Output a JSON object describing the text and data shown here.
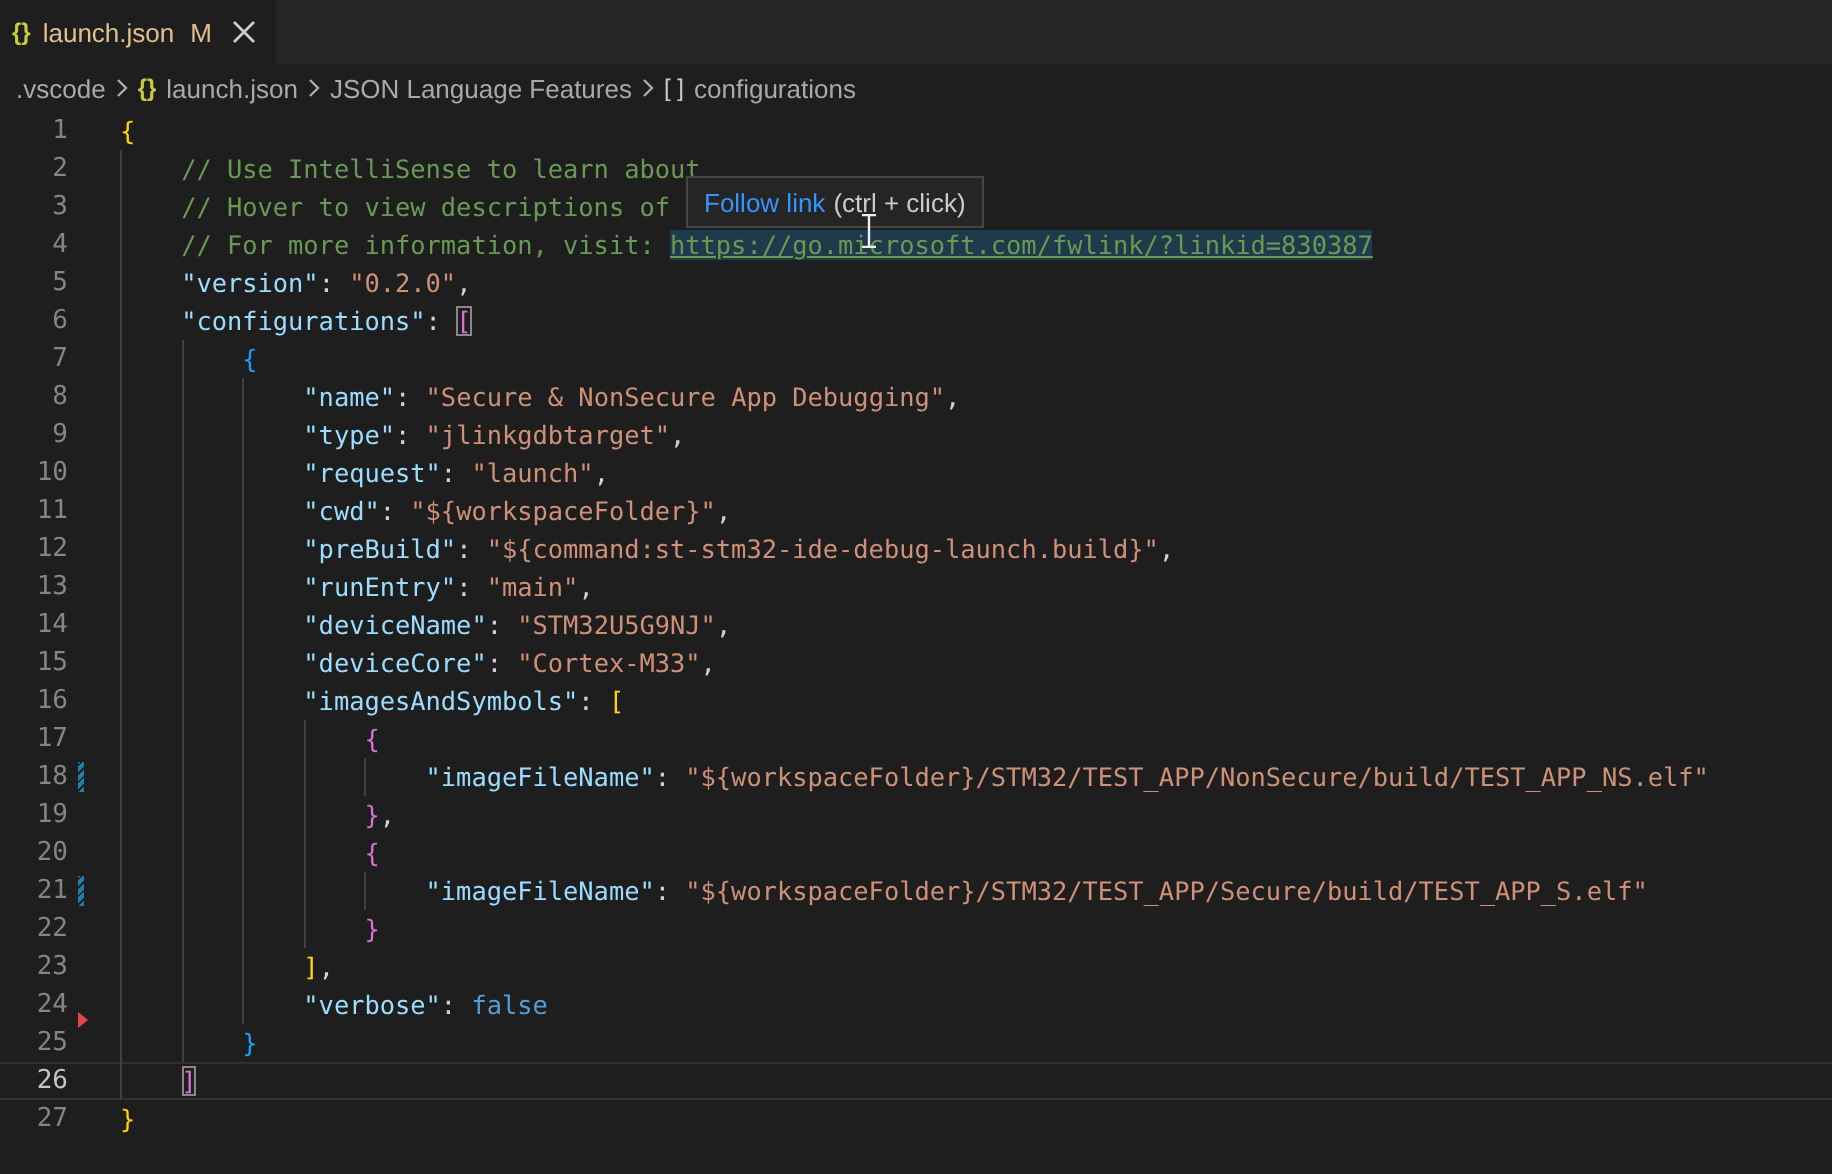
{
  "tab": {
    "icon": "{}",
    "label": "launch.json",
    "status": "M",
    "selected": true
  },
  "breadcrumbs": [
    {
      "label": ".vscode"
    },
    {
      "icon": "{}",
      "label": "launch.json"
    },
    {
      "label": "JSON Language Features"
    },
    {
      "icon": "[ ]",
      "label": "configurations"
    }
  ],
  "lines": [
    {
      "number": "1",
      "tokens": [
        {
          "kind": "bracket",
          "text": "{",
          "color": "#ffd700"
        }
      ]
    },
    {
      "number": "2",
      "tokens": [
        {
          "kind": "comment",
          "text": "    // Use IntelliSense to learn about"
        }
      ]
    },
    {
      "number": "3",
      "tokens": [
        {
          "kind": "comment",
          "text": "    // Hover to view descriptions of"
        }
      ]
    },
    {
      "number": "4",
      "tokens": [
        {
          "kind": "comment",
          "text": "    // For more information, visit: "
        },
        {
          "kind": "link",
          "text": "https://go.microsoft.com/fwlink/?linkid=830387"
        }
      ]
    },
    {
      "number": "5",
      "tokens": [
        {
          "kind": "key",
          "text": "    \"version\""
        },
        {
          "kind": "punct",
          "text": ": "
        },
        {
          "kind": "string",
          "text": "\"0.2.0\""
        },
        {
          "kind": "punct",
          "text": ","
        }
      ]
    },
    {
      "number": "6",
      "tokens": [
        {
          "kind": "key",
          "text": "    \"configurations\""
        },
        {
          "kind": "punct",
          "text": ": "
        },
        {
          "kind": "bracket",
          "text": "[",
          "color": "#da70d6",
          "matched": true
        }
      ]
    },
    {
      "number": "7",
      "tokens": [
        {
          "kind": "bracket",
          "text": "        {",
          "color": "#179fff"
        }
      ]
    },
    {
      "number": "8",
      "tokens": [
        {
          "kind": "key",
          "text": "            \"name\""
        },
        {
          "kind": "punct",
          "text": ": "
        },
        {
          "kind": "string",
          "text": "\"Secure & NonSecure App Debugging\""
        },
        {
          "kind": "punct",
          "text": ","
        }
      ]
    },
    {
      "number": "9",
      "tokens": [
        {
          "kind": "key",
          "text": "            \"type\""
        },
        {
          "kind": "punct",
          "text": ": "
        },
        {
          "kind": "string",
          "text": "\"jlinkgdbtarget\""
        },
        {
          "kind": "punct",
          "text": ","
        }
      ]
    },
    {
      "number": "10",
      "tokens": [
        {
          "kind": "key",
          "text": "            \"request\""
        },
        {
          "kind": "punct",
          "text": ": "
        },
        {
          "kind": "string",
          "text": "\"launch\""
        },
        {
          "kind": "punct",
          "text": ","
        }
      ]
    },
    {
      "number": "11",
      "tokens": [
        {
          "kind": "key",
          "text": "            \"cwd\""
        },
        {
          "kind": "punct",
          "text": ": "
        },
        {
          "kind": "string",
          "text": "\"${workspaceFolder}\""
        },
        {
          "kind": "punct",
          "text": ","
        }
      ]
    },
    {
      "number": "12",
      "tokens": [
        {
          "kind": "key",
          "text": "            \"preBuild\""
        },
        {
          "kind": "punct",
          "text": ": "
        },
        {
          "kind": "string",
          "text": "\"${command:st-stm32-ide-debug-launch.build}\""
        },
        {
          "kind": "punct",
          "text": ","
        }
      ]
    },
    {
      "number": "13",
      "tokens": [
        {
          "kind": "key",
          "text": "            \"runEntry\""
        },
        {
          "kind": "punct",
          "text": ": "
        },
        {
          "kind": "string",
          "text": "\"main\""
        },
        {
          "kind": "punct",
          "text": ","
        }
      ]
    },
    {
      "number": "14",
      "tokens": [
        {
          "kind": "key",
          "text": "            \"deviceName\""
        },
        {
          "kind": "punct",
          "text": ": "
        },
        {
          "kind": "string",
          "text": "\"STM32U5G9NJ\""
        },
        {
          "kind": "punct",
          "text": ","
        }
      ]
    },
    {
      "number": "15",
      "tokens": [
        {
          "kind": "key",
          "text": "            \"deviceCore\""
        },
        {
          "kind": "punct",
          "text": ": "
        },
        {
          "kind": "string",
          "text": "\"Cortex-M33\""
        },
        {
          "kind": "punct",
          "text": ","
        }
      ]
    },
    {
      "number": "16",
      "tokens": [
        {
          "kind": "key",
          "text": "            \"imagesAndSymbols\""
        },
        {
          "kind": "punct",
          "text": ": "
        },
        {
          "kind": "bracket",
          "text": "[",
          "color": "#ffd700"
        }
      ]
    },
    {
      "number": "17",
      "tokens": [
        {
          "kind": "bracket",
          "text": "                {",
          "color": "#da70d6"
        }
      ]
    },
    {
      "number": "18",
      "modified": true,
      "tokens": [
        {
          "kind": "key",
          "text": "                    \"imageFileName\""
        },
        {
          "kind": "punct",
          "text": ": "
        },
        {
          "kind": "string",
          "text": "\"${workspaceFolder}/STM32/TEST_APP/NonSecure/build/TEST_APP_NS.elf\""
        }
      ]
    },
    {
      "number": "19",
      "tokens": [
        {
          "kind": "bracket",
          "text": "                }",
          "color": "#da70d6"
        },
        {
          "kind": "punct",
          "text": ","
        }
      ]
    },
    {
      "number": "20",
      "tokens": [
        {
          "kind": "bracket",
          "text": "                {",
          "color": "#da70d6"
        }
      ]
    },
    {
      "number": "21",
      "modified": true,
      "tokens": [
        {
          "kind": "key",
          "text": "                    \"imageFileName\""
        },
        {
          "kind": "punct",
          "text": ": "
        },
        {
          "kind": "string",
          "text": "\"${workspaceFolder}/STM32/TEST_APP/Secure/build/TEST_APP_S.elf\""
        }
      ]
    },
    {
      "number": "22",
      "tokens": [
        {
          "kind": "bracket",
          "text": "                }",
          "color": "#da70d6"
        }
      ]
    },
    {
      "number": "23",
      "tokens": [
        {
          "kind": "bracket",
          "text": "            ]",
          "color": "#ffd700"
        },
        {
          "kind": "punct",
          "text": ","
        }
      ]
    },
    {
      "number": "24",
      "deleted_below": true,
      "tokens": [
        {
          "kind": "key",
          "text": "            \"verbose\""
        },
        {
          "kind": "punct",
          "text": ": "
        },
        {
          "kind": "keyword",
          "text": "false"
        }
      ]
    },
    {
      "number": "25",
      "tokens": [
        {
          "kind": "bracket",
          "text": "        }",
          "color": "#179fff"
        }
      ]
    },
    {
      "number": "26",
      "current": true,
      "tokens": [
        {
          "kind": "bracket",
          "text": "    ]",
          "color": "#da70d6",
          "matched": true
        }
      ]
    },
    {
      "number": "27",
      "tokens": [
        {
          "kind": "bracket",
          "text": "}",
          "color": "#ffd700"
        }
      ]
    }
  ],
  "tooltip": {
    "link": "Follow link",
    "hint": "(ctrl + click)"
  }
}
